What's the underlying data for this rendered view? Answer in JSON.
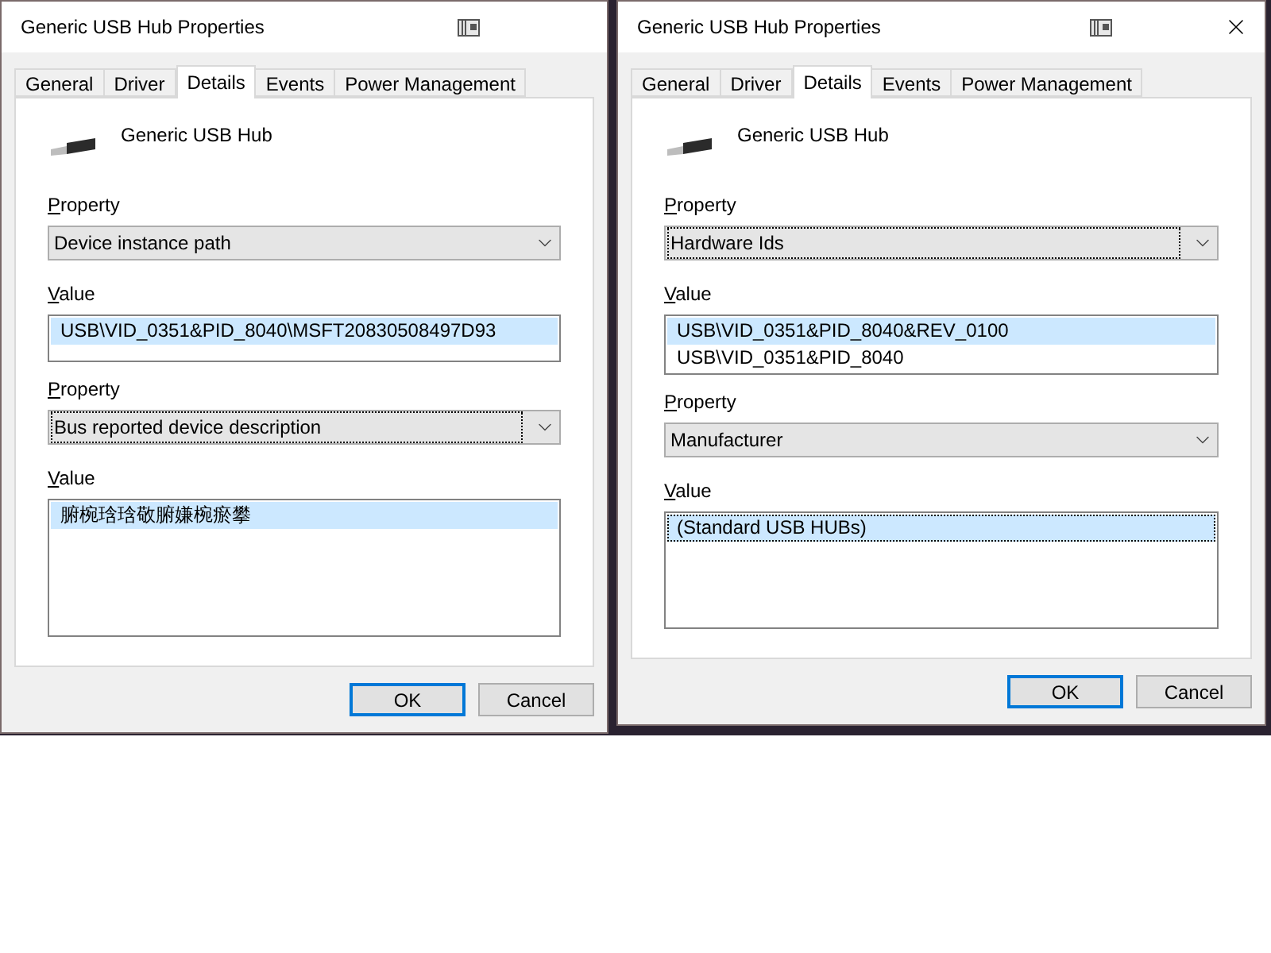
{
  "dialogs": [
    {
      "title": "Generic USB Hub Properties",
      "close_visible": false,
      "tabs": [
        {
          "label": "General",
          "selected": false
        },
        {
          "label": "Driver",
          "selected": false
        },
        {
          "label": "Details",
          "selected": true
        },
        {
          "label": "Events",
          "selected": false
        },
        {
          "label": "Power Management",
          "selected": false
        }
      ],
      "device_name": "Generic USB Hub",
      "sections": [
        {
          "property_label": "Property",
          "property": "Device instance path",
          "focused": false,
          "value_label": "Value",
          "values": [
            {
              "text": "USB\\VID_0351&PID_8040\\MSFT20830508497D93",
              "selected": true,
              "focused": false
            }
          ]
        },
        {
          "property_label": "Property",
          "property": "Bus reported device description",
          "focused": true,
          "value_label": "Value",
          "values": [
            {
              "text": "腑椀琀琀敬腑嫌椀瘀攀",
              "selected": true,
              "focused": false
            }
          ]
        }
      ],
      "buttons": [
        {
          "label": "OK",
          "default": true
        },
        {
          "label": "Cancel",
          "default": false
        }
      ]
    },
    {
      "title": "Generic USB Hub Properties",
      "close_visible": true,
      "tabs": [
        {
          "label": "General",
          "selected": false
        },
        {
          "label": "Driver",
          "selected": false
        },
        {
          "label": "Details",
          "selected": true
        },
        {
          "label": "Events",
          "selected": false
        },
        {
          "label": "Power Management",
          "selected": false
        }
      ],
      "device_name": "Generic USB Hub",
      "sections": [
        {
          "property_label": "Property",
          "property": "Hardware Ids",
          "focused": true,
          "value_label": "Value",
          "values": [
            {
              "text": "USB\\VID_0351&PID_8040&REV_0100",
              "selected": true,
              "focused": false
            },
            {
              "text": "USB\\VID_0351&PID_8040",
              "selected": false,
              "focused": false
            }
          ]
        },
        {
          "property_label": "Property",
          "property": "Manufacturer",
          "focused": false,
          "value_label": "Value",
          "values": [
            {
              "text": "(Standard USB HUBs)",
              "selected": true,
              "focused": true
            }
          ]
        }
      ],
      "buttons": [
        {
          "label": "OK",
          "default": true
        },
        {
          "label": "Cancel",
          "default": false
        }
      ]
    }
  ]
}
